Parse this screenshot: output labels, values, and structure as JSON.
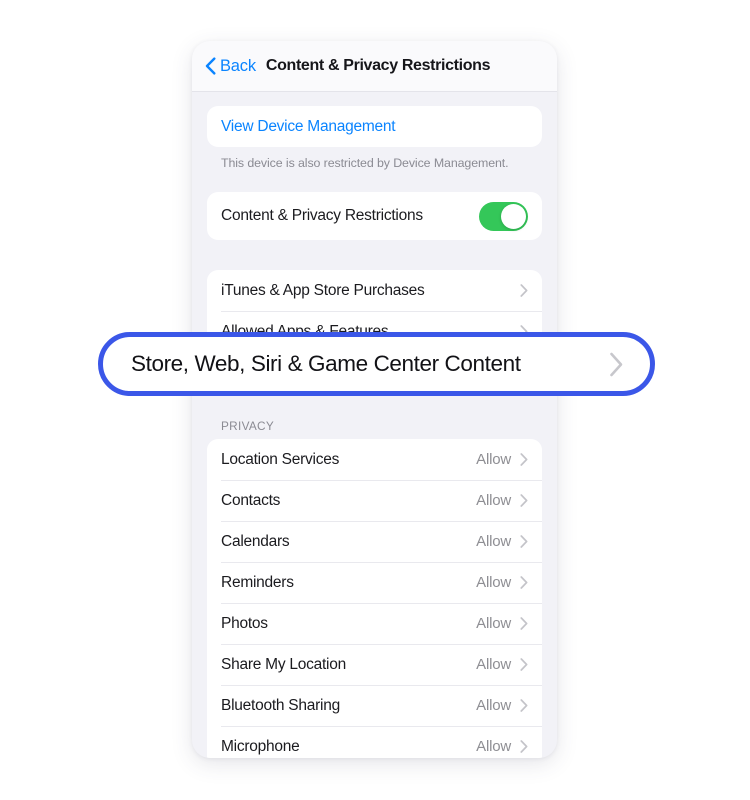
{
  "navbar": {
    "back_label": "Back",
    "back_icon": "chevron-left-icon",
    "title": "Content & Privacy Restrictions"
  },
  "device_management": {
    "link_label": "View Device Management",
    "footnote": "This device is also restricted by Device Management."
  },
  "master_toggle": {
    "label": "Content & Privacy Restrictions",
    "state": "on",
    "color": "#34c759"
  },
  "restriction_rows": [
    {
      "label": "iTunes & App Store Purchases",
      "chevron": "chevron-right-icon"
    },
    {
      "label": "Allowed Apps & Features",
      "chevron": "chevron-right-icon"
    }
  ],
  "callout": {
    "label": "Store, Web, Siri & Game Center Content",
    "chevron": "chevron-right-icon",
    "border_color": "#3b57e8"
  },
  "privacy": {
    "section_header": "PRIVACY",
    "rows": [
      {
        "label": "Location Services",
        "value": "Allow"
      },
      {
        "label": "Contacts",
        "value": "Allow"
      },
      {
        "label": "Calendars",
        "value": "Allow"
      },
      {
        "label": "Reminders",
        "value": "Allow"
      },
      {
        "label": "Photos",
        "value": "Allow"
      },
      {
        "label": "Share My Location",
        "value": "Allow"
      },
      {
        "label": "Bluetooth Sharing",
        "value": "Allow"
      },
      {
        "label": "Microphone",
        "value": "Allow"
      }
    ]
  }
}
